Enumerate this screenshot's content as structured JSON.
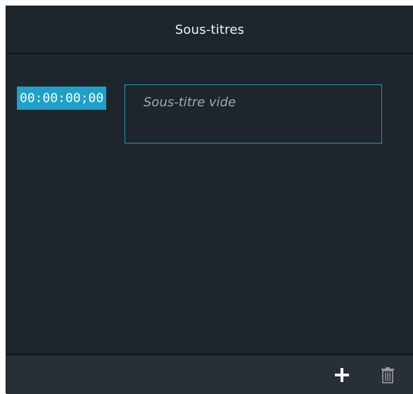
{
  "panel": {
    "title": "Sous-titres"
  },
  "subtitle": {
    "timecode": "00:00:00;00",
    "placeholder": "Sous-titre vide"
  },
  "footer": {
    "add_icon": "plus-icon",
    "delete_icon": "trash-icon"
  },
  "colors": {
    "background": "#1f252c",
    "accent": "#1ea0c8",
    "footer": "#292f36"
  }
}
